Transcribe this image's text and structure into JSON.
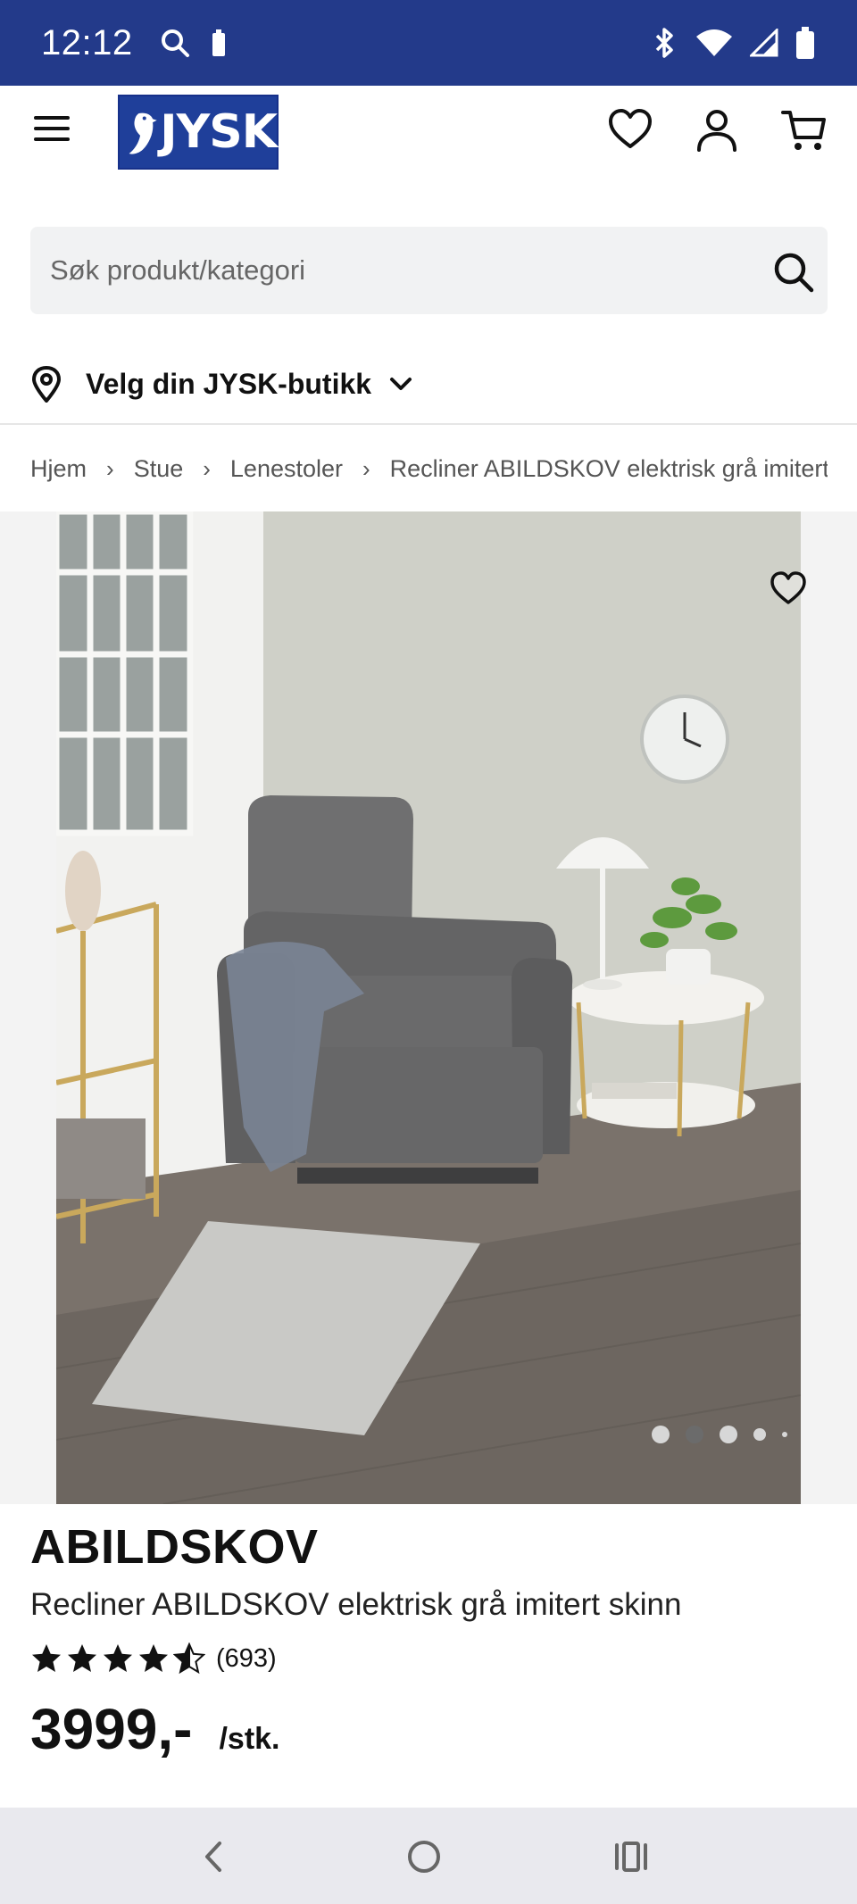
{
  "status_bar": {
    "time": "12:12",
    "left_icons": [
      "search-icon",
      "battery-saver-icon"
    ],
    "right_icons": [
      "bluetooth-icon",
      "wifi-icon",
      "signal-icon",
      "battery-icon"
    ],
    "background_color": "#233a8a"
  },
  "header": {
    "logo_text": "JYSK",
    "icons": [
      "menu-icon",
      "heart-icon",
      "user-icon",
      "cart-icon"
    ],
    "brand_color": "#1f3f9a"
  },
  "search": {
    "placeholder": "Søk produkt/kategori",
    "value": ""
  },
  "store_picker": {
    "label": "Velg din JYSK-butikk"
  },
  "breadcrumb": {
    "items": [
      "Hjem",
      "Stue",
      "Lenestoler",
      "Recliner ABILDSKOV elektrisk grå imitert"
    ]
  },
  "gallery": {
    "image_count_dots": 5,
    "active_index": 1
  },
  "product": {
    "brand": "ABILDSKOV",
    "name": "Recliner ABILDSKOV elektrisk grå imitert skinn",
    "rating": 4.5,
    "review_count": "(693)",
    "price": "3999,-",
    "unit": "/stk."
  },
  "nav_bar": {
    "icons": [
      "back-icon",
      "home-icon",
      "recent-apps-icon"
    ]
  }
}
